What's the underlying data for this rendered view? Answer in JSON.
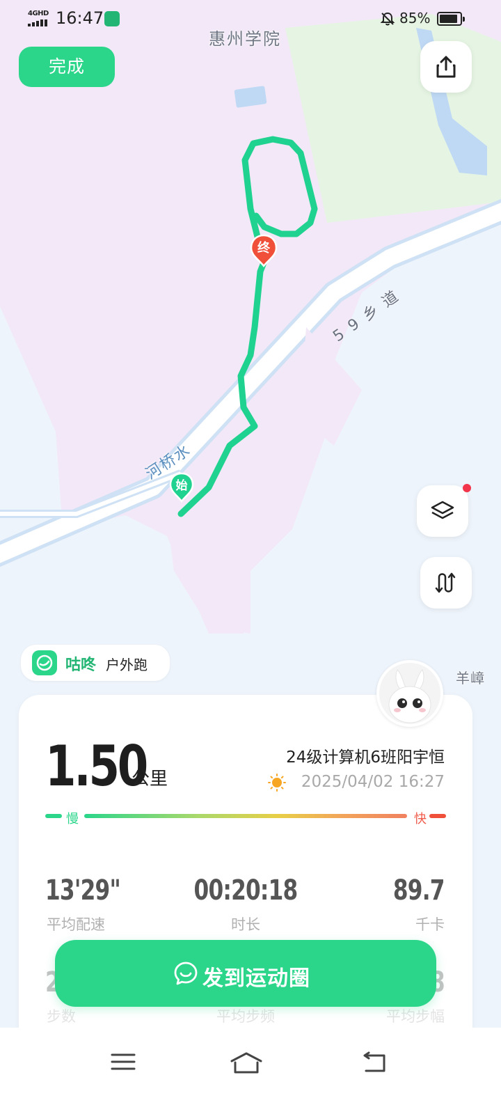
{
  "status_bar": {
    "network": "4GHD",
    "time": "16:47",
    "battery": "85%"
  },
  "toolbar": {
    "done_label": "完成"
  },
  "map": {
    "place_label": "惠州学院",
    "road_label": "59乡道",
    "river_label": "河桥水",
    "side_label": "羊嶂",
    "start_marker": "始",
    "end_marker": "终"
  },
  "brand": {
    "name": "咕咚",
    "activity_type": "户外跑"
  },
  "summary": {
    "distance": "1.50",
    "distance_unit": "公里",
    "user_name": "24级计算机6班阳宇恒",
    "datetime": "2025/04/02 16:27",
    "speed_slow_label": "慢",
    "speed_fast_label": "快"
  },
  "metrics": [
    {
      "value": "13'29\"",
      "label": "平均配速"
    },
    {
      "value": "00:20:18",
      "label": "时长"
    },
    {
      "value": "89.7",
      "label": "千卡"
    }
  ],
  "metrics_row2": [
    {
      "value": "2",
      "label": "步数"
    },
    {
      "value": "",
      "label": "平均步频"
    },
    {
      "value": "8",
      "label": "平均步幅"
    }
  ],
  "share_button_label": "发到运动圈",
  "colors": {
    "accent": "#2bd68b",
    "route": "#1fd28f",
    "end_marker": "#f0503a"
  }
}
